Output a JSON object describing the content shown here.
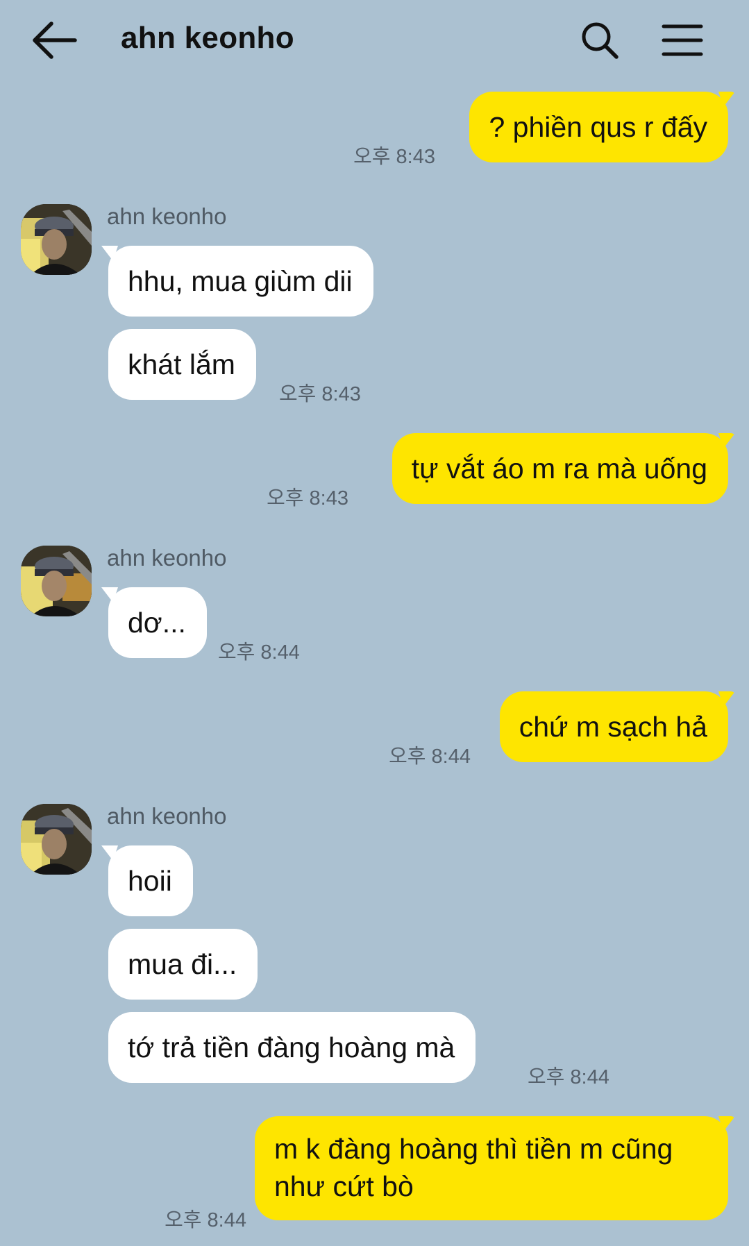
{
  "header": {
    "title": "ahn keonho",
    "back_icon": "arrow-left-icon",
    "search_icon": "search-icon",
    "menu_icon": "hamburger-menu-icon"
  },
  "colors": {
    "background": "#abc1d1",
    "outgoing_bubble": "#fee500",
    "incoming_bubble": "#ffffff"
  },
  "messages": [
    {
      "direction": "out",
      "text": "? phiền qus r đấy",
      "time": "오후 8:43"
    },
    {
      "direction": "in",
      "sender": "ahn keonho",
      "texts": [
        "hhu, mua giùm dii",
        "khát lắm"
      ],
      "time": "오후 8:43"
    },
    {
      "direction": "out",
      "text": "tự vắt áo m ra mà uống",
      "time": "오후 8:43"
    },
    {
      "direction": "in",
      "sender": "ahn keonho",
      "texts": [
        "dơ..."
      ],
      "time": "오후 8:44"
    },
    {
      "direction": "out",
      "text": "chứ m sạch hả",
      "time": "오후 8:44"
    },
    {
      "direction": "in",
      "sender": "ahn keonho",
      "texts": [
        "hoii",
        "mua đi...",
        "tớ trả tiền đàng hoàng mà"
      ],
      "time": "오후 8:44"
    },
    {
      "direction": "out",
      "text": "m k đàng hoàng thì tiền m cũng như cứt bò",
      "time": "오후 8:44"
    }
  ]
}
